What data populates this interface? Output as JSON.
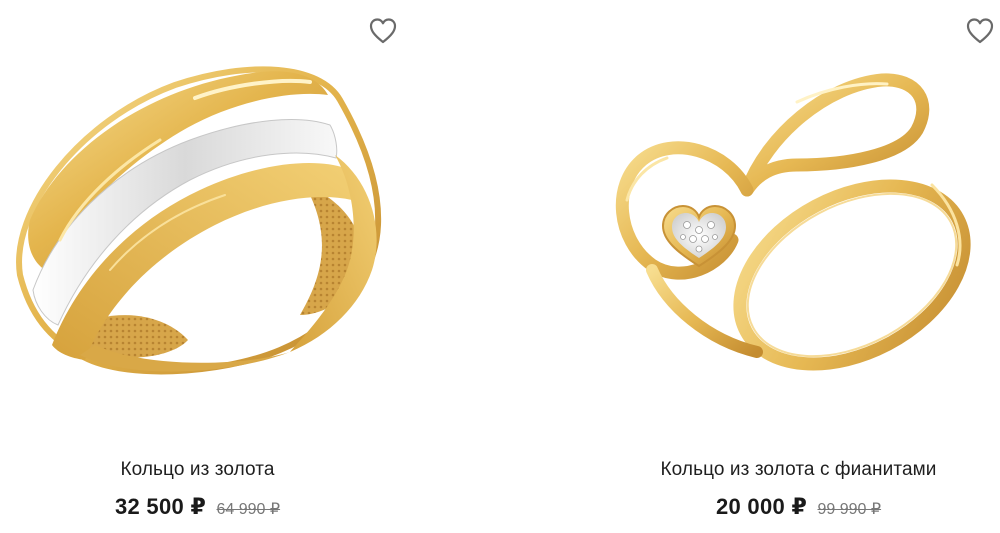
{
  "products": [
    {
      "title": "Кольцо из золота",
      "price": "32 500 ₽",
      "old_price": "64 990 ₽",
      "image_icon": "gold-white-gold-ring-image",
      "favorite_icon": "heart-outline-icon"
    },
    {
      "title": "Кольцо из золота с фианитами",
      "price": "20 000 ₽",
      "old_price": "99 990 ₽",
      "image_icon": "infinity-heart-ring-image",
      "favorite_icon": "heart-outline-icon"
    }
  ],
  "colors": {
    "gold_light": "#F6D98A",
    "gold": "#E2B449",
    "gold_dark": "#B9852A",
    "white_gold": "#F3F3F3",
    "price_text": "#1A1A1A",
    "old_price_text": "#777777"
  }
}
